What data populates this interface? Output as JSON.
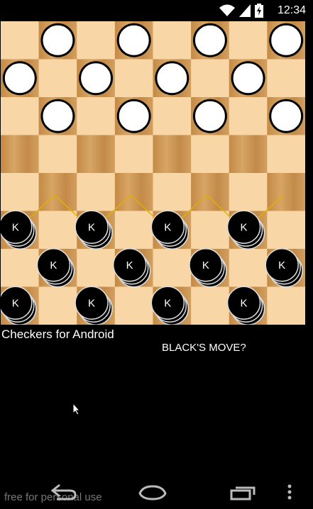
{
  "status_bar": {
    "time": "12:34",
    "icons": [
      "wifi-icon",
      "signal-icon",
      "battery-charging-icon"
    ]
  },
  "board": {
    "size": 8,
    "colors": {
      "light_square": "#f9d6a6",
      "dark_square": "#c9934f",
      "white_piece": "#ffffff",
      "black_piece": "#000000",
      "move_path": "#e0b000"
    },
    "white_pieces": [
      [
        0,
        1
      ],
      [
        0,
        3
      ],
      [
        0,
        5
      ],
      [
        0,
        7
      ],
      [
        1,
        0
      ],
      [
        1,
        2
      ],
      [
        1,
        4
      ],
      [
        1,
        6
      ],
      [
        2,
        1
      ],
      [
        2,
        3
      ],
      [
        2,
        5
      ],
      [
        2,
        7
      ]
    ],
    "black_pieces": [
      [
        5,
        0
      ],
      [
        5,
        2
      ],
      [
        5,
        4
      ],
      [
        5,
        6
      ],
      [
        6,
        1
      ],
      [
        6,
        3
      ],
      [
        6,
        5
      ],
      [
        6,
        7
      ],
      [
        7,
        0
      ],
      [
        7,
        2
      ],
      [
        7,
        4
      ],
      [
        7,
        6
      ]
    ],
    "king_label": "K"
  },
  "app_title": "Checkers for Android",
  "move_status": "BLACK'S MOVE?",
  "watermark": "free for personal use",
  "nav": [
    "back-icon",
    "home-icon",
    "recent-apps-icon",
    "overflow-menu-icon"
  ]
}
